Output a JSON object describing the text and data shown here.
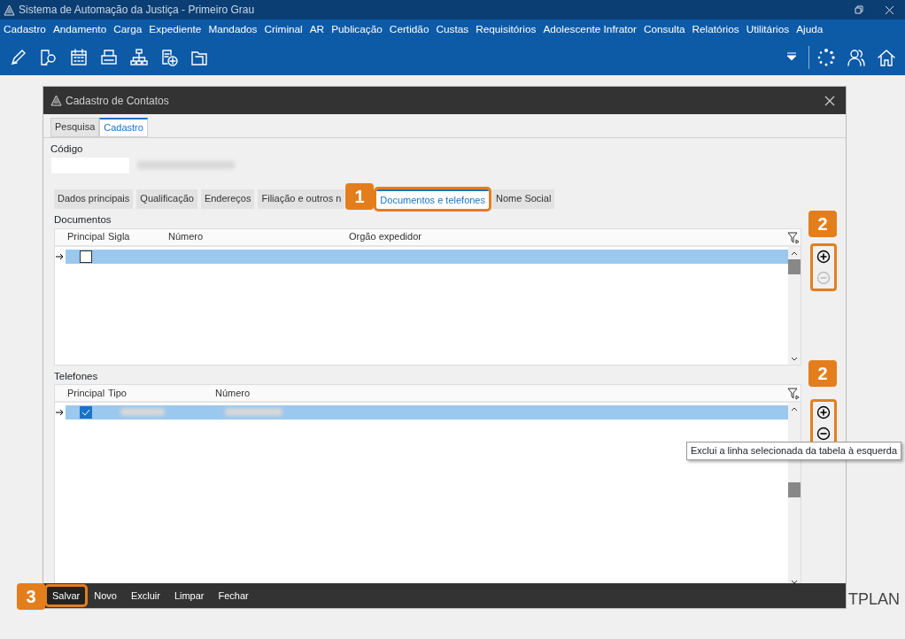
{
  "window": {
    "title": "Sistema de Automação da Justiça - Primeiro Grau"
  },
  "menu": [
    "Cadastro",
    "Andamento",
    "Carga",
    "Expediente",
    "Mandados",
    "Criminal",
    "AR",
    "Publicação",
    "Certidão",
    "Custas",
    "Requisitórios",
    "Adolescente Infrator",
    "Consulta",
    "Relatórios",
    "Utilitários",
    "Ajuda"
  ],
  "dialog": {
    "title": "Cadastro de Contatos",
    "tabs": [
      {
        "label": "Pesquisa",
        "selected": false
      },
      {
        "label": "Cadastro",
        "selected": true
      }
    ],
    "codigo_label": "Código",
    "subtabs": [
      {
        "label": "Dados principais",
        "selected": false
      },
      {
        "label": "Qualificação",
        "selected": false
      },
      {
        "label": "Endereços",
        "selected": false
      },
      {
        "label": "Filiação e outros n",
        "selected": false
      },
      {
        "label": "Documentos e telefones",
        "selected": true
      },
      {
        "label": "Nome Social",
        "selected": false
      }
    ],
    "grids": [
      {
        "label": "Documentos",
        "columns": [
          "Principal",
          "Sigla",
          "Número",
          "Orgão expedidor"
        ],
        "rows": [
          {
            "principal": false,
            "selected": true
          }
        ],
        "remove_disabled": true
      },
      {
        "label": "Telefones",
        "columns": [
          "Principal",
          "Tipo",
          "Número"
        ],
        "rows": [
          {
            "principal": true,
            "selected": true
          }
        ],
        "remove_disabled": false
      }
    ],
    "actions": [
      {
        "label": "Salvar",
        "selected": true
      },
      {
        "label": "Novo",
        "selected": false
      },
      {
        "label": "Excluir",
        "selected": false
      },
      {
        "label": "Limpar",
        "selected": false
      },
      {
        "label": "Fechar",
        "selected": false
      }
    ]
  },
  "tooltip": "Exclui a linha selecionada da tabela à esquerda",
  "background_text": "TPLAN",
  "callouts": [
    "1",
    "2",
    "2",
    "3"
  ]
}
